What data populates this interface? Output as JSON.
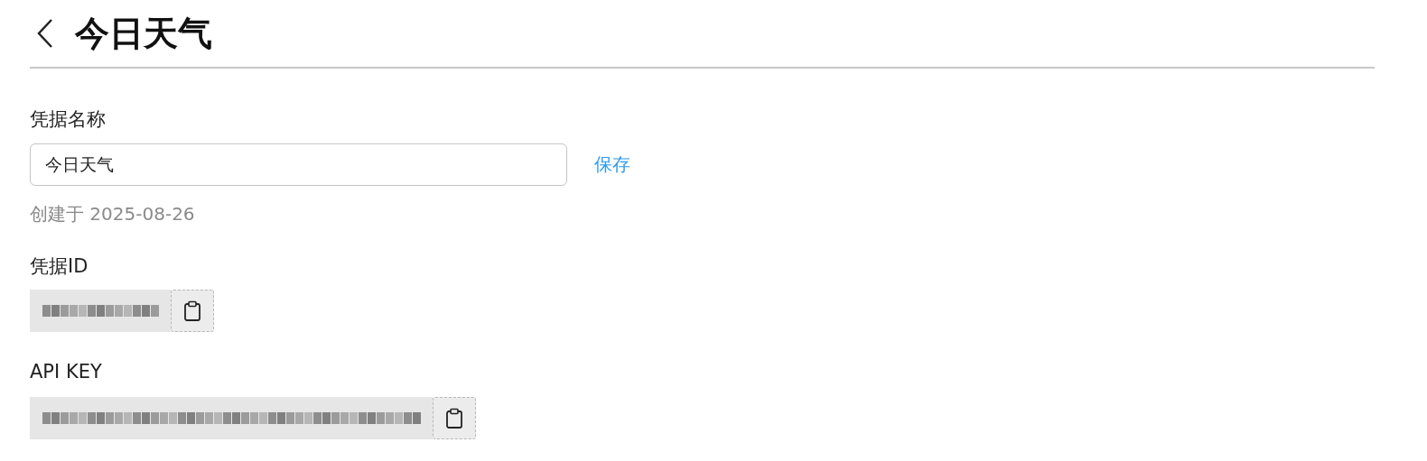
{
  "header": {
    "title": "今日天气"
  },
  "name_field": {
    "label": "凭据名称",
    "value": "今日天气",
    "save": "保存"
  },
  "created": "创建于 2025-08-26",
  "secrets": [
    {
      "label": "凭据ID"
    },
    {
      "label": "API KEY"
    }
  ]
}
